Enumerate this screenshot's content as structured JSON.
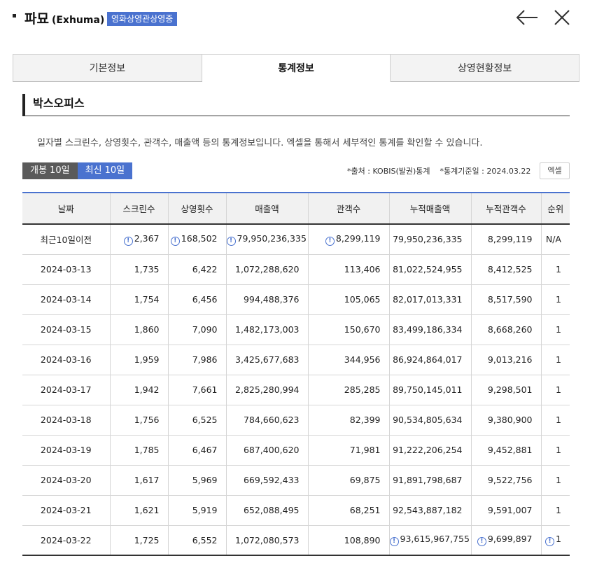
{
  "header": {
    "title": "파묘",
    "subtitle": "(Exhuma)",
    "badge": "영화상영관상영중"
  },
  "tabs": [
    {
      "label": "기본정보"
    },
    {
      "label": "통계정보"
    },
    {
      "label": "상영현황정보"
    }
  ],
  "section": {
    "title": "박스오피스",
    "description": "일자별 스크린수, 상영횟수, 관객수, 매출액 등의 통계정보입니다. 엑셀을 통해서 세부적인 통계를 확인할 수 있습니다."
  },
  "filters": {
    "opening_label": "개봉 10일",
    "latest_label": "최신 10일"
  },
  "source": {
    "text": "*출처 : KOBIS(발권)통계    *통계기준일 : 2024.03.22"
  },
  "excel_label": "엑셀",
  "table": {
    "headers": [
      "날짜",
      "스크린수",
      "상영횟수",
      "매출액",
      "관객수",
      "누적매출액",
      "누적관객수",
      "순위"
    ],
    "rows": [
      [
        "최근10일이전",
        "2,367",
        "168,502",
        "79,950,236,335",
        "8,299,119",
        "79,950,236,335",
        "8,299,119",
        "N/A"
      ],
      [
        "2024-03-13",
        "1,735",
        "6,422",
        "1,072,288,620",
        "113,406",
        "81,022,524,955",
        "8,412,525",
        "1"
      ],
      [
        "2024-03-14",
        "1,754",
        "6,456",
        "994,488,376",
        "105,065",
        "82,017,013,331",
        "8,517,590",
        "1"
      ],
      [
        "2024-03-15",
        "1,860",
        "7,090",
        "1,482,173,003",
        "150,670",
        "83,499,186,334",
        "8,668,260",
        "1"
      ],
      [
        "2024-03-16",
        "1,959",
        "7,986",
        "3,425,677,683",
        "344,956",
        "86,924,864,017",
        "9,013,216",
        "1"
      ],
      [
        "2024-03-17",
        "1,942",
        "7,661",
        "2,825,280,994",
        "285,285",
        "89,750,145,011",
        "9,298,501",
        "1"
      ],
      [
        "2024-03-18",
        "1,756",
        "6,525",
        "784,660,623",
        "82,399",
        "90,534,805,634",
        "9,380,900",
        "1"
      ],
      [
        "2024-03-19",
        "1,785",
        "6,467",
        "687,400,620",
        "71,981",
        "91,222,206,254",
        "9,452,881",
        "1"
      ],
      [
        "2024-03-20",
        "1,617",
        "5,969",
        "669,592,433",
        "69,875",
        "91,891,798,687",
        "9,522,756",
        "1"
      ],
      [
        "2024-03-21",
        "1,621",
        "5,919",
        "652,088,495",
        "68,251",
        "92,543,887,182",
        "9,591,007",
        "1"
      ],
      [
        "2024-03-22",
        "1,725",
        "6,552",
        "1,072,080,573",
        "108,890",
        "93,615,967,755",
        "9,699,897",
        "1"
      ]
    ]
  },
  "icons": {
    "info": "info-circle-icon",
    "info_glyph": "!"
  },
  "colors": {
    "accent": "#4a72cf",
    "dark_button": "#5a5a5a"
  }
}
